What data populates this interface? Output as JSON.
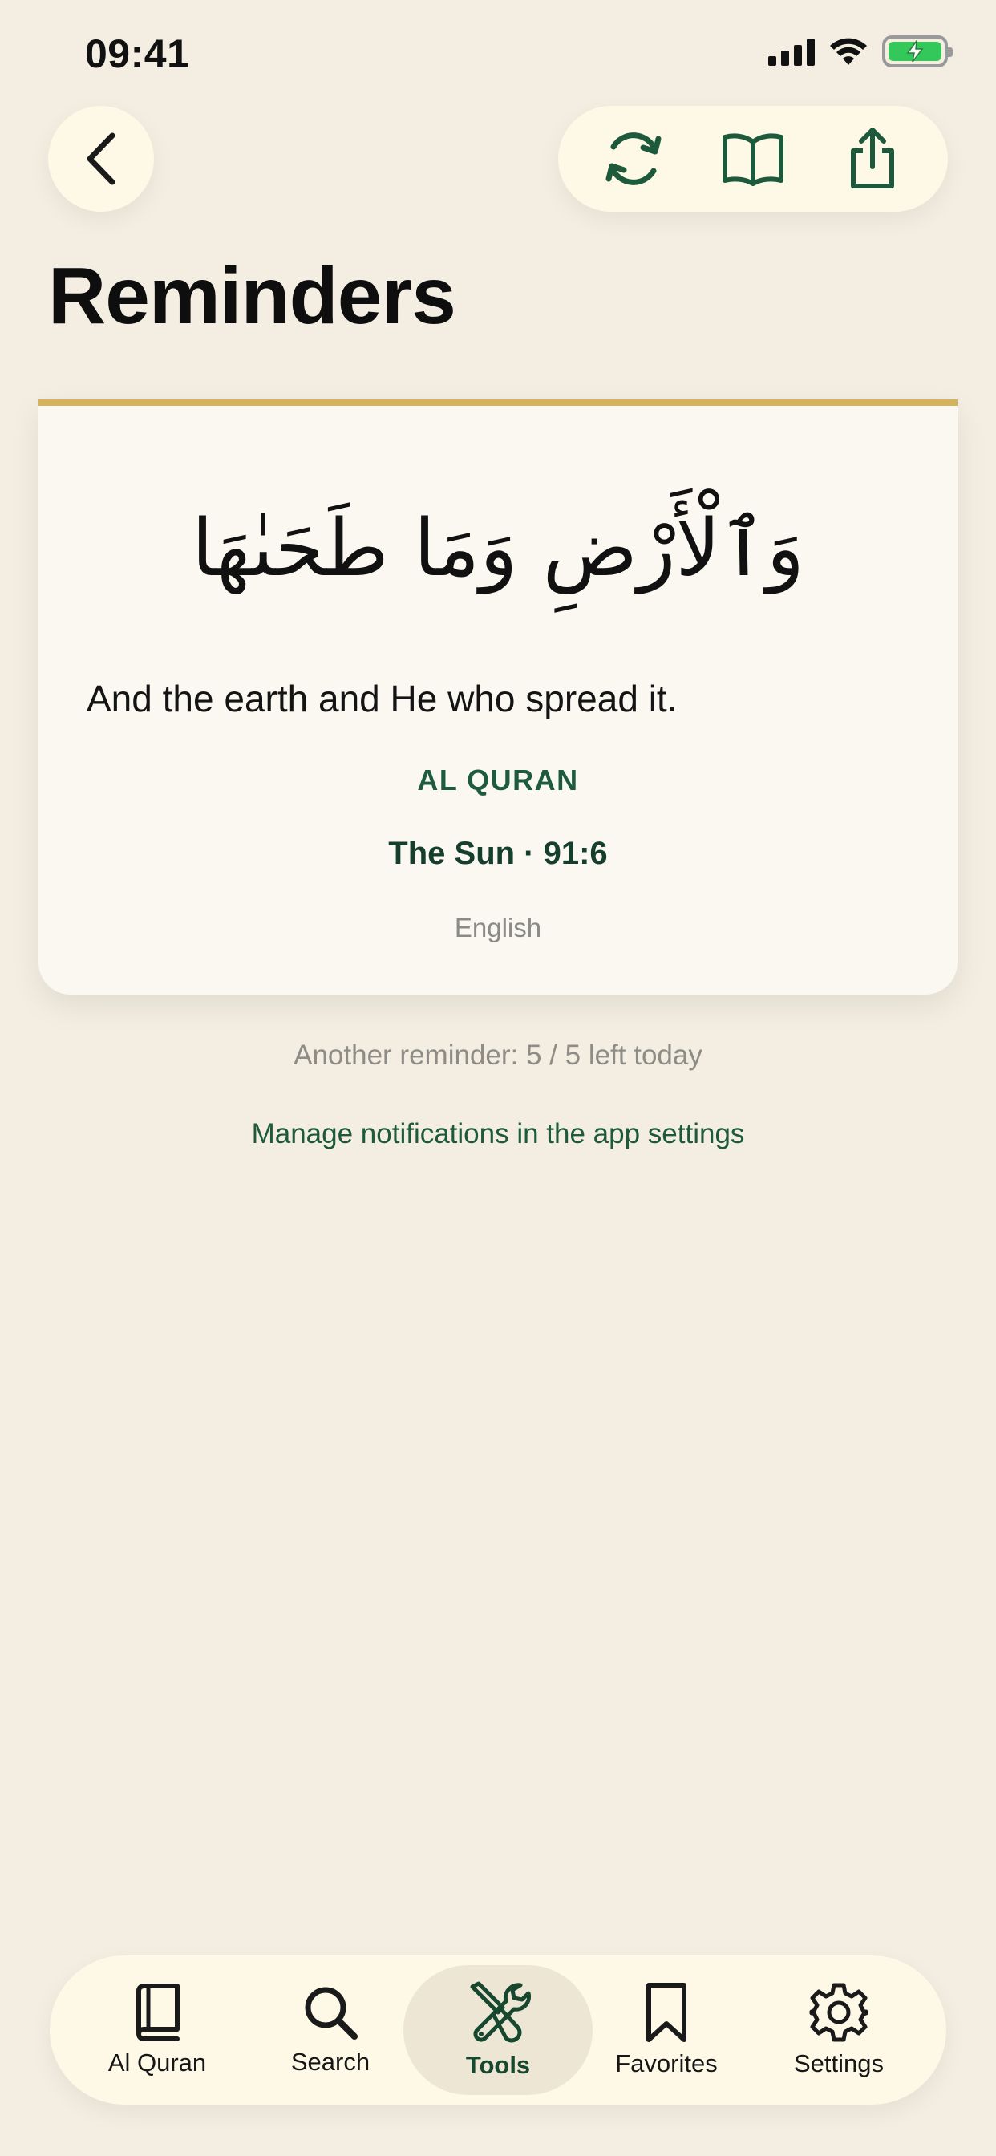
{
  "status_bar": {
    "time": "09:41"
  },
  "header": {
    "title": "Reminders",
    "back_icon": "chevron-left-icon",
    "actions": [
      "refresh-icon",
      "book-open-icon",
      "share-icon"
    ]
  },
  "reminder": {
    "arabic": "وَٱلْأَرْضِ وَمَا طَحَىٰهَا",
    "translation": "And the earth and He who spread it.",
    "source": "AL QURAN",
    "reference": "The Sun · 91:6",
    "language": "English"
  },
  "footer": {
    "remaining": "Another reminder: 5 / 5 left today",
    "manage_link": "Manage notifications in the app settings"
  },
  "tabs": [
    {
      "label": "Al Quran",
      "icon": "book-icon"
    },
    {
      "label": "Search",
      "icon": "search-icon"
    },
    {
      "label": "Tools",
      "icon": "tools-icon",
      "active": true
    },
    {
      "label": "Favorites",
      "icon": "bookmark-icon"
    },
    {
      "label": "Settings",
      "icon": "gear-icon"
    }
  ],
  "colors": {
    "background": "#f3eee1",
    "accent_green": "#1e5a3c",
    "card_border_gold": "#d4b35c",
    "pill_bg": "#fdf9e6"
  }
}
